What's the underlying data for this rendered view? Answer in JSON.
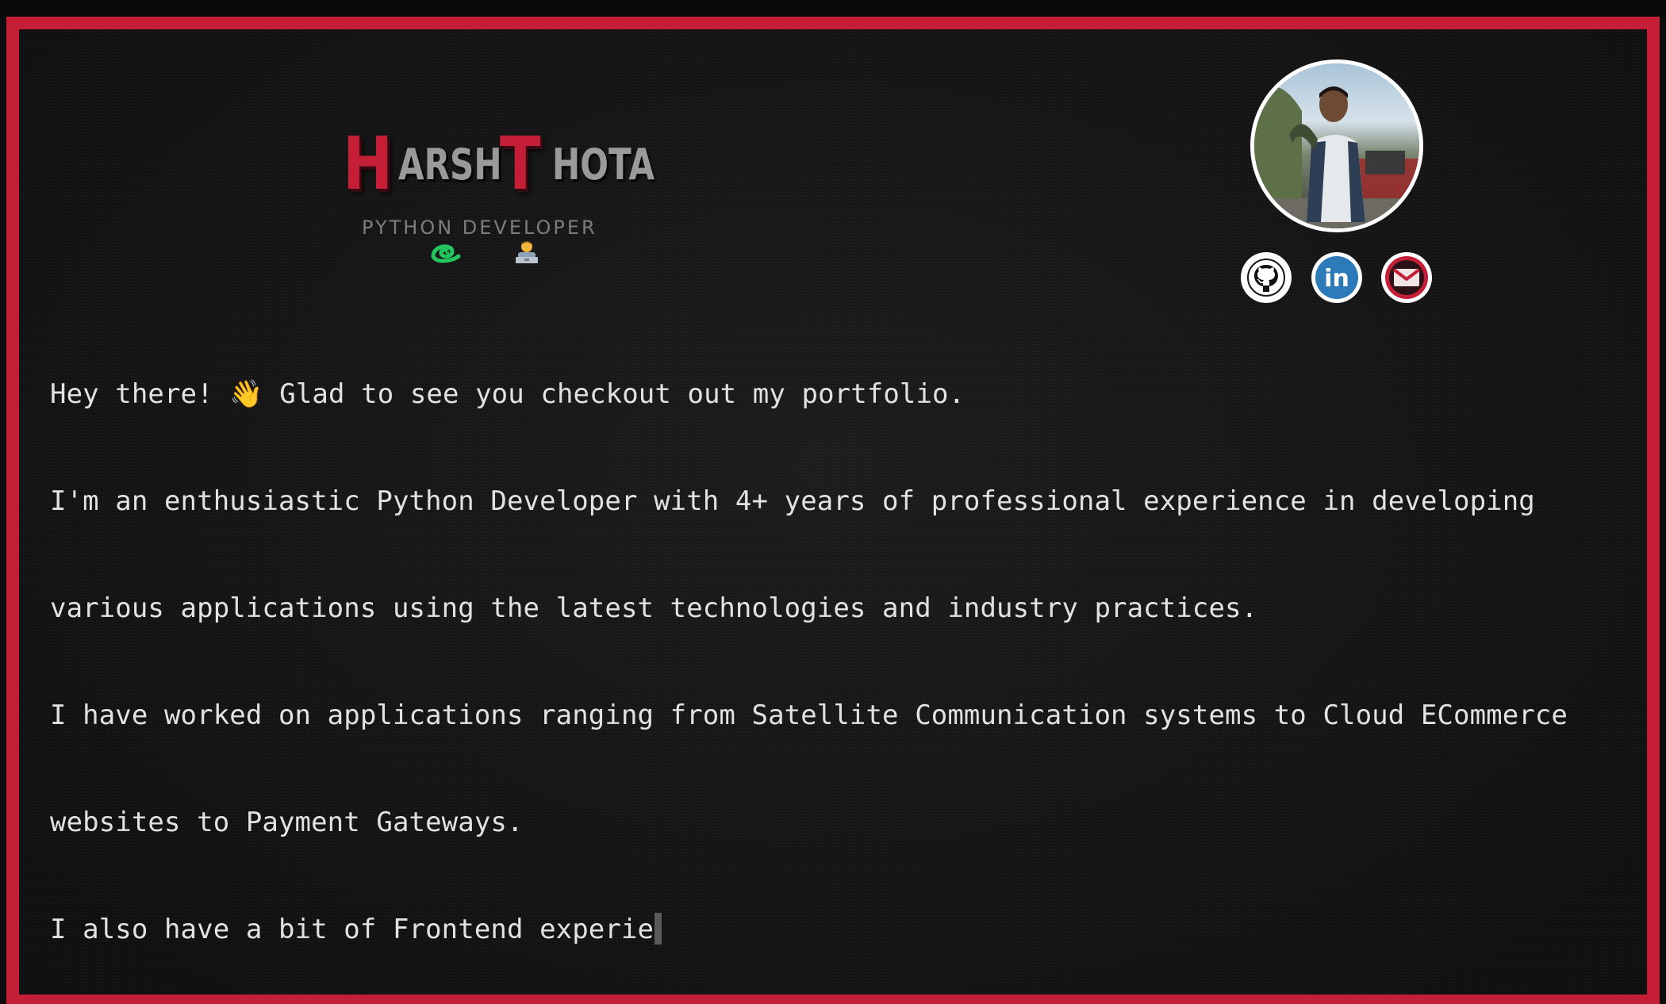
{
  "logo": {
    "first_initial": "H",
    "first_rest": "ARSH",
    "last_initial": "T",
    "last_rest": "HOTA"
  },
  "subtitle": "PYTHON DEVELOPER",
  "icons": {
    "python": "snake-icon",
    "developer": "technologist-icon",
    "github": "github-icon",
    "linkedin": "linkedin-icon",
    "gmail": "gmail-icon"
  },
  "social": {
    "linkedin_text": "in"
  },
  "intro": {
    "line1": "Hey there! 👋 Glad to see you checkout out my portfolio.",
    "line2": "I'm an enthusiastic Python Developer with 4+ years of professional experience in developing",
    "line3": "various applications using the latest technologies and industry practices.",
    "line4": "I have worked on applications ranging from Satellite Communication systems to Cloud ECommerce",
    "line5": "websites to Payment Gateways.",
    "line6": "I also have a bit of Frontend experie"
  },
  "colors": {
    "accent": "#c41f36",
    "background": "#141414",
    "text": "#e2e2e2",
    "linkedin": "#2d7ab8",
    "gmail": "#c41f36"
  }
}
